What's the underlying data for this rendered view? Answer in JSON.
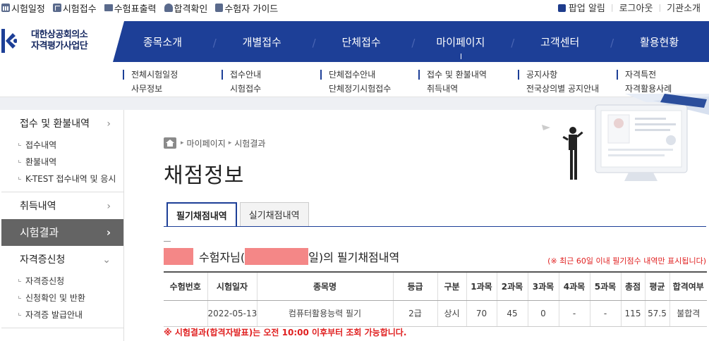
{
  "topbar": {
    "left_links": [
      {
        "icon": "calendar-icon",
        "label": "시험일정"
      },
      {
        "icon": "edit-icon",
        "label": "시험접수"
      },
      {
        "icon": "print-icon",
        "label": "수험표출력"
      },
      {
        "icon": "award-icon",
        "label": "합격확인"
      },
      {
        "icon": "book-icon",
        "label": "수험자 가이드"
      }
    ],
    "right_links": [
      "팝업 알림",
      "로그아웃",
      "기관소개"
    ]
  },
  "logo": {
    "line1": "대한상공회의소",
    "line2": "자격평가사업단"
  },
  "nav": [
    "종목소개",
    "개별접수",
    "단체접수",
    "마이페이지",
    "고객센터",
    "활용현황"
  ],
  "submenu": [
    [
      "전체시험일정",
      "사무정보"
    ],
    [
      "접수안내",
      "시험접수"
    ],
    [
      "단체접수안내",
      "단체정기시험접수"
    ],
    [
      "접수 및 환불내역",
      "취득내역"
    ],
    [
      "공지사항",
      "전국상의별 공지안내"
    ],
    [
      "자격특전",
      "자격활용사례"
    ]
  ],
  "sidebar": {
    "sec1": "접수 및 환불내역",
    "sec1_items": [
      "접수내역",
      "환불내역",
      "K-TEST 접수내역 및 응시"
    ],
    "sec2": "취득내역",
    "active": "시험결과",
    "sec4": "자격증신청",
    "sec4_items": [
      "자격증신청",
      "신청확인 및 반환",
      "자격증 발급안내"
    ]
  },
  "breadcrumb": [
    "마이페이지",
    "시험결과"
  ],
  "page_title": "채점정보",
  "tabs": [
    "필기채점내역",
    "실기채점내역"
  ],
  "candidate": {
    "prefix": "수험자님(",
    "suffix": "일)의 필기채점내역"
  },
  "note": "(※ 최근 60일 이내 필기점수 내역만 표시됩니다)",
  "table": {
    "headers": [
      "수험번호",
      "시험일자",
      "종목명",
      "등급",
      "구분",
      "1과목",
      "2과목",
      "3과목",
      "4과목",
      "5과목",
      "총점",
      "평균",
      "합격여부"
    ],
    "rows": [
      [
        "",
        "2022-05-13",
        "컴퓨터활용능력 필기",
        "2급",
        "상시",
        "70",
        "45",
        "0",
        "-",
        "-",
        "115",
        "57.5",
        "불합격"
      ]
    ]
  },
  "bottom_note": "※ 시험결과(합격자발표)는 오전 10:00 이후부터 조회 가능합니다.",
  "colors": {
    "nav_bg": "#1d3f97",
    "accent_red": "#e02020",
    "masked": "#f48787",
    "sidebar_active": "#646464"
  }
}
